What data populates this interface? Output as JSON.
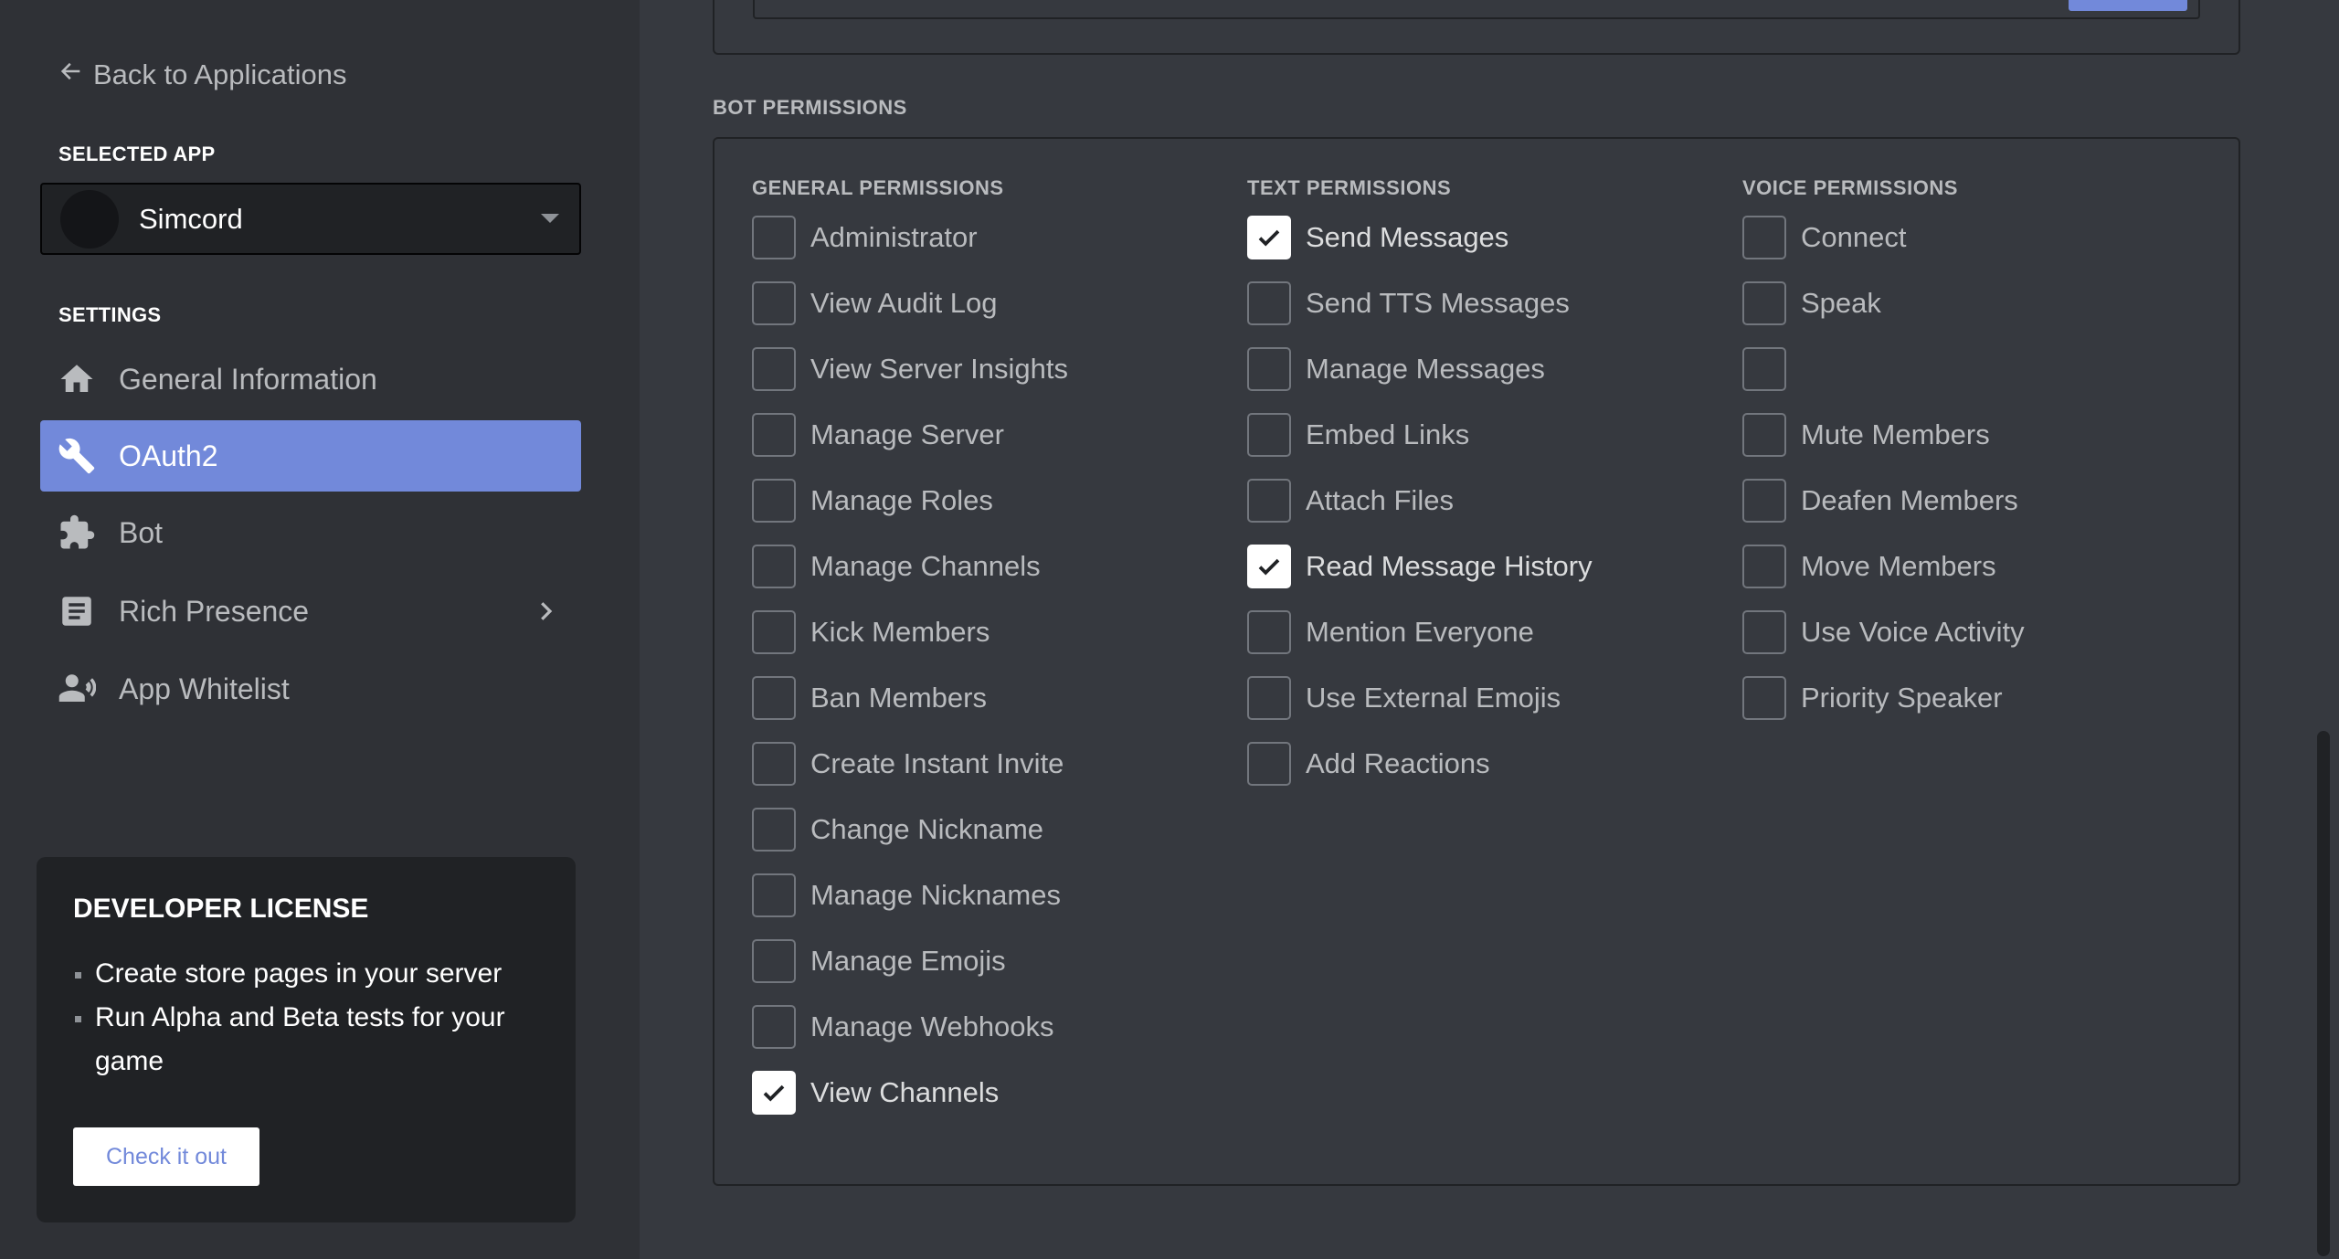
{
  "sidebar": {
    "back_label": "Back to Applications",
    "selected_app_title": "SELECTED APP",
    "selected_app_name": "Simcord",
    "settings_title": "SETTINGS",
    "items": [
      {
        "label": "General Information",
        "icon": "home-icon",
        "active": false
      },
      {
        "label": "OAuth2",
        "icon": "wrench-icon",
        "active": true
      },
      {
        "label": "Bot",
        "icon": "puzzle-icon",
        "active": false
      },
      {
        "label": "Rich Presence",
        "icon": "document-icon",
        "active": false,
        "has_chevron": true
      },
      {
        "label": "App Whitelist",
        "icon": "person-phone-icon",
        "active": false
      }
    ]
  },
  "license": {
    "title": "DEVELOPER LICENSE",
    "bullets": [
      "Create store pages in your server",
      "Run Alpha and Beta tests for your game"
    ],
    "button_label": "Check it out"
  },
  "bot_permissions": {
    "title": "BOT PERMISSIONS",
    "columns": [
      {
        "title": "GENERAL PERMISSIONS",
        "items": [
          {
            "label": "Administrator",
            "checked": false
          },
          {
            "label": "View Audit Log",
            "checked": false
          },
          {
            "label": "View Server Insights",
            "checked": false
          },
          {
            "label": "Manage Server",
            "checked": false
          },
          {
            "label": "Manage Roles",
            "checked": false
          },
          {
            "label": "Manage Channels",
            "checked": false
          },
          {
            "label": "Kick Members",
            "checked": false
          },
          {
            "label": "Ban Members",
            "checked": false
          },
          {
            "label": "Create Instant Invite",
            "checked": false
          },
          {
            "label": "Change Nickname",
            "checked": false
          },
          {
            "label": "Manage Nicknames",
            "checked": false
          },
          {
            "label": "Manage Emojis",
            "checked": false
          },
          {
            "label": "Manage Webhooks",
            "checked": false
          },
          {
            "label": "View Channels",
            "checked": true
          }
        ]
      },
      {
        "title": "TEXT PERMISSIONS",
        "items": [
          {
            "label": "Send Messages",
            "checked": true
          },
          {
            "label": "Send TTS Messages",
            "checked": false
          },
          {
            "label": "Manage Messages",
            "checked": false
          },
          {
            "label": "Embed Links",
            "checked": false
          },
          {
            "label": "Attach Files",
            "checked": false
          },
          {
            "label": "Read Message History",
            "checked": true
          },
          {
            "label": "Mention Everyone",
            "checked": false
          },
          {
            "label": "Use External Emojis",
            "checked": false
          },
          {
            "label": "Add Reactions",
            "checked": false
          }
        ]
      },
      {
        "title": "VOICE PERMISSIONS",
        "items": [
          {
            "label": "Connect",
            "checked": false
          },
          {
            "label": "Speak",
            "checked": false
          },
          {
            "label": "",
            "checked": false
          },
          {
            "label": "Mute Members",
            "checked": false
          },
          {
            "label": "Deafen Members",
            "checked": false
          },
          {
            "label": "Move Members",
            "checked": false
          },
          {
            "label": "Use Voice Activity",
            "checked": false
          },
          {
            "label": "Priority Speaker",
            "checked": false
          }
        ]
      }
    ]
  },
  "colors": {
    "accent": "#7289da",
    "sidebar_bg": "#2f3136",
    "main_bg": "#36393f",
    "card_bg": "#202225"
  }
}
